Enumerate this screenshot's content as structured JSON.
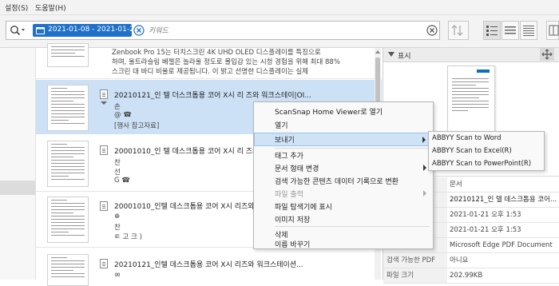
{
  "menubar": {
    "items": [
      "설정(S)",
      "도움말(H)"
    ]
  },
  "search": {
    "date_range": "2021-01-08 - 2021-01-21",
    "placeholder": "키워드"
  },
  "list": {
    "top_snippet": [
      "Zenbook Pro 15는 터치스크린 4K UHD OLED 디스플레이를 특징으로",
      "하며, 울트라슬림 베젤은 놀라울 정도로 몰입감 있는 시청 경험을 위해 최대 88%",
      "스크린 대 바디 비율로 제공됩니다. 이 밝고 선명한 디스플레이는 실제"
    ],
    "items": [
      {
        "title": "20210121_인 텔 더스크톱용 코어 X시 리 즈와 워크스테이|OI...",
        "lines": [
          "손",
          "@ ☎",
          "[행사 참고자료]"
        ]
      },
      {
        "title": "20001010_인 텔 데스크톱용 코어 X시 리 즈와 워",
        "lines": [
          "찬",
          "선",
          "G ☎"
        ]
      },
      {
        "title": "20001010_인텔 데스크톱용 코어 X시 리즈와 워",
        "lines": [
          "⊕",
          "찬",
          "ㅌ 고 크 )"
        ]
      },
      {
        "title": "20210121_인텔 데스크톱용 코어 X시 리즈와 워크스테이션...",
        "lines": [
          "ㆀ"
        ]
      }
    ]
  },
  "context_menu": {
    "items": [
      "ScanSnap Home Viewer로 열기",
      "열기",
      "보내기",
      "태그 추가",
      "문서 형태 변경",
      "검색 가능한 콘텐츠 데이터 기록으로 변환",
      "파일 출력",
      "파일 탐색기에 표시",
      "이미지 저장",
      "삭제",
      "이름 바꾸기"
    ],
    "submenu": [
      "ABBYY Scan to Word",
      "ABBYY Scan to Excel(R)",
      "ABBYY Scan to PowerPoint(R)"
    ]
  },
  "right_panel": {
    "header": "표시",
    "details": [
      {
        "label": "",
        "value": "문서"
      },
      {
        "label": "",
        "value": "20210121_인 텔 데스크톱용 코어..."
      },
      {
        "label": "",
        "value": "2021-01-21 오후 1:53"
      },
      {
        "label": "",
        "value": "2021-01-21 오후 1:53"
      },
      {
        "label": "",
        "value": "Microsoft Edge PDF Document"
      },
      {
        "label": "검색 가능한 PDF",
        "value": "아니요"
      },
      {
        "label": "파일 크기",
        "value": "202.99KB"
      }
    ]
  },
  "colors": {
    "accent": "#1e70c9",
    "selection": "#cde1f6",
    "highlight": "#cfe3f7"
  }
}
